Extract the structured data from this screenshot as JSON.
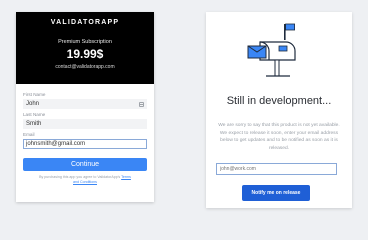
{
  "signup": {
    "brand": "VALIDATORAPP",
    "plan": "Premium Subscription",
    "price": "19.99$",
    "contact": "contact@validatorapp.com",
    "fields": [
      {
        "label": "First Name",
        "value": "John"
      },
      {
        "label": "Last Name",
        "value": "Smith"
      },
      {
        "label": "Email",
        "value": "johnsmith@gmail.com"
      }
    ],
    "continue_label": "Continue",
    "terms_text": "By purchasing this app you agree to ValidatorApp's ",
    "terms_link_1": "Terms",
    "terms_link_2": "and Conditions"
  },
  "development": {
    "title": "Still in development...",
    "description": "We are sorry to say that this product is not yet available. We expect to release it soon, enter your email address below to get updates and to be notified as soon as it is released.",
    "email_placeholder": "john@work.com",
    "notify_label": "Notify me on release"
  },
  "colors": {
    "primary": "#3a86f5",
    "notify": "#1f5fd6",
    "mailbox_blue": "#3a86f5",
    "mailbox_dark": "#1f2b3d"
  }
}
